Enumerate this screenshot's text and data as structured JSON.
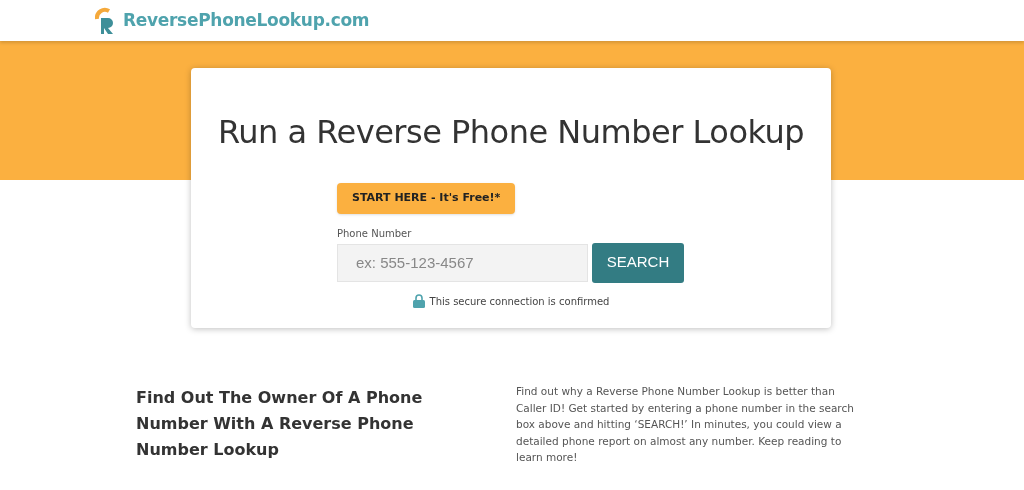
{
  "header": {
    "logo_text": "ReversePhoneLookup.com"
  },
  "search_card": {
    "title": "Run a Reverse Phone Number Lookup",
    "callout": "START HERE - It's Free!*",
    "field_label": "Phone Number",
    "placeholder": "ex: 555-123-4567",
    "button": "SEARCH",
    "secure_note": "This secure connection is confirmed"
  },
  "intro": {
    "heading": "Find Out The Owner Of A Phone Number With A Reverse Phone Number Lookup",
    "body": "Find out why a Reverse Phone Number Lookup is better than Caller ID! Get started by entering a phone number in the search box above and hitting ‘SEARCH!’ In minutes, you could view a detailed phone report on almost any number. Keep reading to learn more!"
  }
}
